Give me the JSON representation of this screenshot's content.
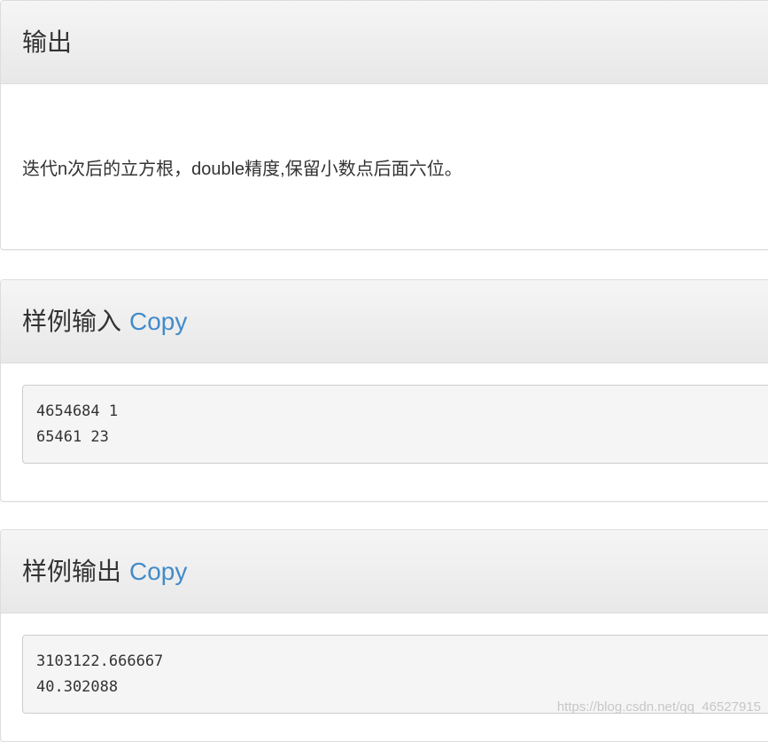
{
  "output_panel": {
    "title": "输出",
    "body": "迭代n次后的立方根，double精度,保留小数点后面六位。"
  },
  "sample_input_panel": {
    "title": "样例输入",
    "copy_label": "Copy",
    "content": "4654684 1\n65461 23"
  },
  "sample_output_panel": {
    "title": "样例输出",
    "copy_label": "Copy",
    "content": "3103122.666667\n40.302088"
  },
  "watermark": "https://blog.csdn.net/qq_46527915",
  "colors": {
    "link": "#428bca",
    "heading_bg_top": "#f5f5f5",
    "heading_bg_bottom": "#e8e8e8",
    "border": "#dddddd",
    "pre_bg": "#f5f5f5"
  }
}
